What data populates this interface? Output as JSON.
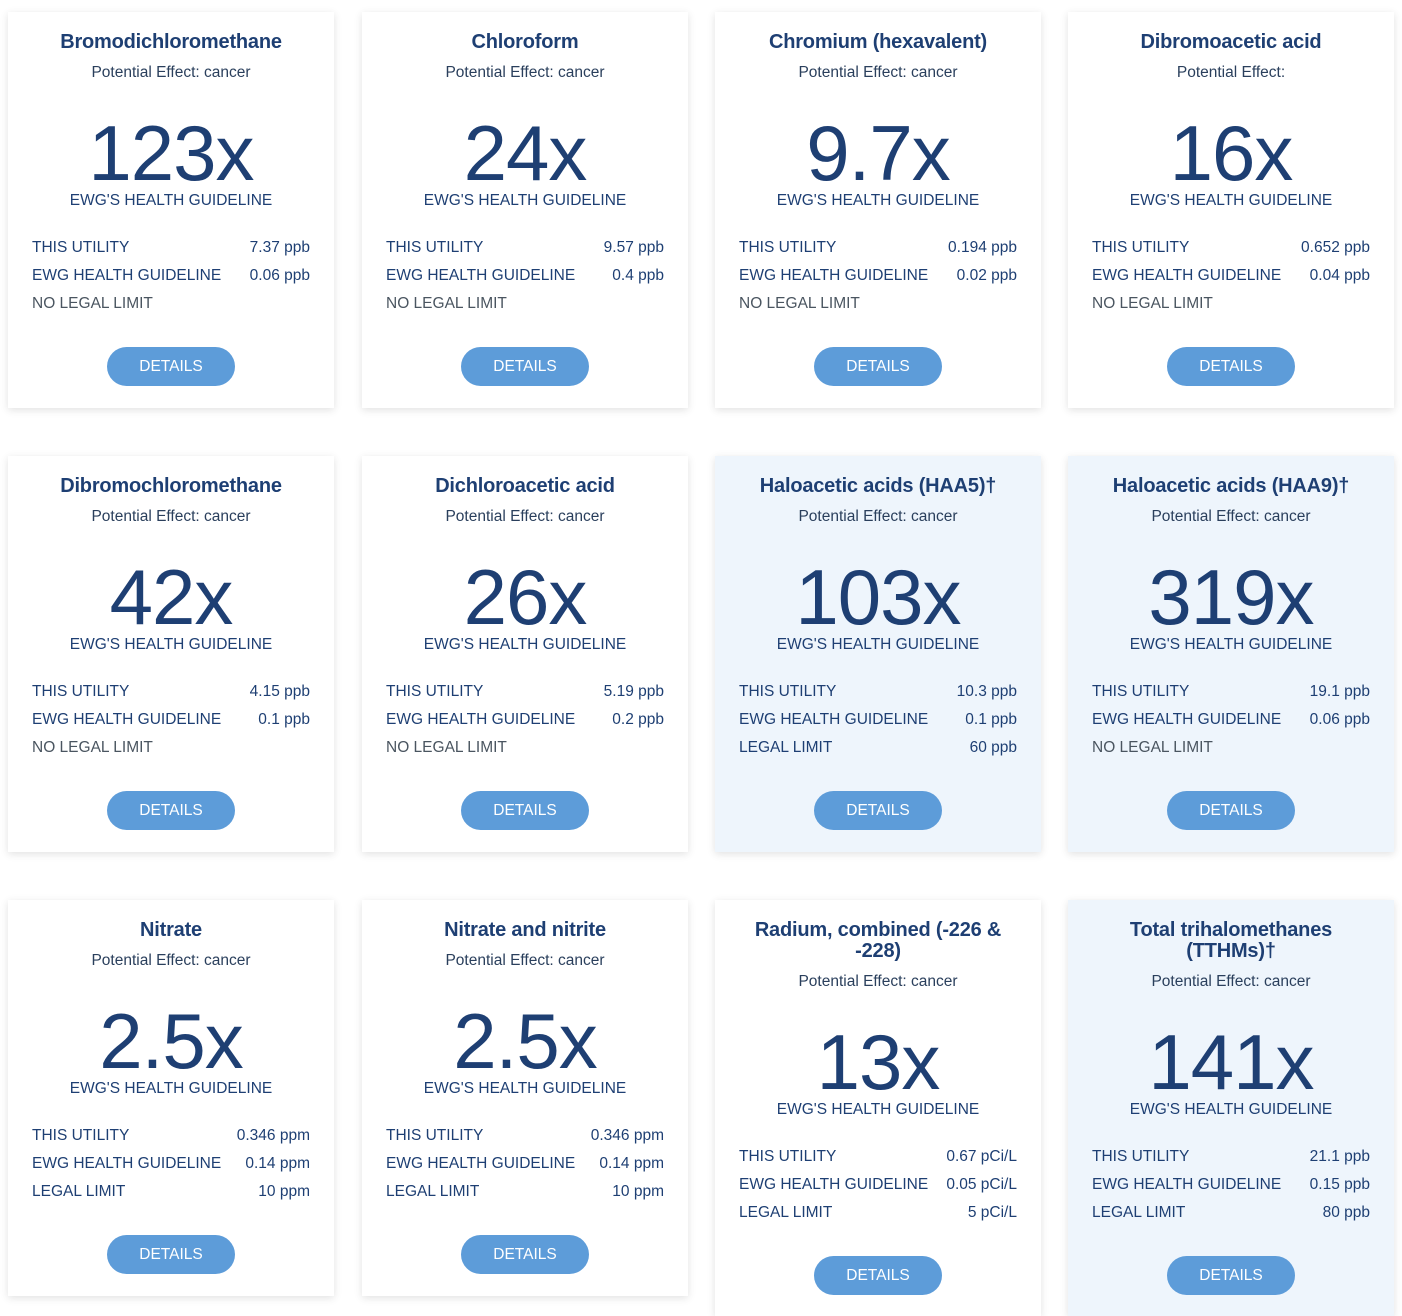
{
  "cards": [
    {
      "title": "Bromodichloromethane",
      "effect": "Potential Effect: cancer",
      "multiple": "123x",
      "guideline_label": "EWG'S HEALTH GUIDELINE",
      "stats": [
        {
          "label": "THIS UTILITY",
          "value": "7.37 ppb"
        },
        {
          "label": "EWG HEALTH GUIDELINE",
          "value": "0.06 ppb"
        },
        {
          "label": "NO LEGAL LIMIT",
          "value": ""
        }
      ],
      "button": "DETAILS"
    },
    {
      "title": "Chloroform",
      "effect": "Potential Effect: cancer",
      "multiple": "24x",
      "guideline_label": "EWG'S HEALTH GUIDELINE",
      "stats": [
        {
          "label": "THIS UTILITY",
          "value": "9.57 ppb"
        },
        {
          "label": "EWG HEALTH GUIDELINE",
          "value": "0.4 ppb"
        },
        {
          "label": "NO LEGAL LIMIT",
          "value": ""
        }
      ],
      "button": "DETAILS"
    },
    {
      "title": "Chromium (hexavalent)",
      "effect": "Potential Effect: cancer",
      "multiple": "9.7x",
      "guideline_label": "EWG'S HEALTH GUIDELINE",
      "stats": [
        {
          "label": "THIS UTILITY",
          "value": "0.194 ppb"
        },
        {
          "label": "EWG HEALTH GUIDELINE",
          "value": "0.02 ppb"
        },
        {
          "label": "NO LEGAL LIMIT",
          "value": ""
        }
      ],
      "button": "DETAILS"
    },
    {
      "title": "Dibromoacetic acid",
      "effect": "Potential Effect:",
      "multiple": "16x",
      "guideline_label": "EWG'S HEALTH GUIDELINE",
      "stats": [
        {
          "label": "THIS UTILITY",
          "value": "0.652 ppb"
        },
        {
          "label": "EWG HEALTH GUIDELINE",
          "value": "0.04 ppb"
        },
        {
          "label": "NO LEGAL LIMIT",
          "value": ""
        }
      ],
      "button": "DETAILS"
    },
    {
      "title": "Dibromochloromethane",
      "effect": "Potential Effect: cancer",
      "multiple": "42x",
      "guideline_label": "EWG'S HEALTH GUIDELINE",
      "stats": [
        {
          "label": "THIS UTILITY",
          "value": "4.15 ppb"
        },
        {
          "label": "EWG HEALTH GUIDELINE",
          "value": "0.1 ppb"
        },
        {
          "label": "NO LEGAL LIMIT",
          "value": ""
        }
      ],
      "button": "DETAILS"
    },
    {
      "title": "Dichloroacetic acid",
      "effect": "Potential Effect: cancer",
      "multiple": "26x",
      "guideline_label": "EWG'S HEALTH GUIDELINE",
      "stats": [
        {
          "label": "THIS UTILITY",
          "value": "5.19 ppb"
        },
        {
          "label": "EWG HEALTH GUIDELINE",
          "value": "0.2 ppb"
        },
        {
          "label": "NO LEGAL LIMIT",
          "value": ""
        }
      ],
      "button": "DETAILS"
    },
    {
      "title": "Haloacetic acids (HAA5)†",
      "effect": "Potential Effect: cancer",
      "multiple": "103x",
      "guideline_label": "EWG'S HEALTH GUIDELINE",
      "stats": [
        {
          "label": "THIS UTILITY",
          "value": "10.3 ppb"
        },
        {
          "label": "EWG HEALTH GUIDELINE",
          "value": "0.1 ppb"
        },
        {
          "label": "LEGAL LIMIT",
          "value": "60 ppb"
        }
      ],
      "button": "DETAILS"
    },
    {
      "title": "Haloacetic acids (HAA9)†",
      "effect": "Potential Effect: cancer",
      "multiple": "319x",
      "guideline_label": "EWG'S HEALTH GUIDELINE",
      "stats": [
        {
          "label": "THIS UTILITY",
          "value": "19.1 ppb"
        },
        {
          "label": "EWG HEALTH GUIDELINE",
          "value": "0.06 ppb"
        },
        {
          "label": "NO LEGAL LIMIT",
          "value": ""
        }
      ],
      "button": "DETAILS"
    },
    {
      "title": "Nitrate",
      "effect": "Potential Effect: cancer",
      "multiple": "2.5x",
      "guideline_label": "EWG'S HEALTH GUIDELINE",
      "stats": [
        {
          "label": "THIS UTILITY",
          "value": "0.346 ppm"
        },
        {
          "label": "EWG HEALTH GUIDELINE",
          "value": "0.14 ppm"
        },
        {
          "label": "LEGAL LIMIT",
          "value": "10 ppm"
        }
      ],
      "button": "DETAILS"
    },
    {
      "title": "Nitrate and nitrite",
      "effect": "Potential Effect: cancer",
      "multiple": "2.5x",
      "guideline_label": "EWG'S HEALTH GUIDELINE",
      "stats": [
        {
          "label": "THIS UTILITY",
          "value": "0.346 ppm"
        },
        {
          "label": "EWG HEALTH GUIDELINE",
          "value": "0.14 ppm"
        },
        {
          "label": "LEGAL LIMIT",
          "value": "10 ppm"
        }
      ],
      "button": "DETAILS"
    },
    {
      "title": "Radium, combined (-226 & -228)",
      "effect": "Potential Effect: cancer",
      "multiple": "13x",
      "guideline_label": "EWG'S HEALTH GUIDELINE",
      "stats": [
        {
          "label": "THIS UTILITY",
          "value": "0.67 pCi/L"
        },
        {
          "label": "EWG HEALTH GUIDELINE",
          "value": "0.05 pCi/L"
        },
        {
          "label": "LEGAL LIMIT",
          "value": "5 pCi/L"
        }
      ],
      "button": "DETAILS"
    },
    {
      "title": "Total trihalomethanes (TTHMs)†",
      "effect": "Potential Effect: cancer",
      "multiple": "141x",
      "guideline_label": "EWG'S HEALTH GUIDELINE",
      "stats": [
        {
          "label": "THIS UTILITY",
          "value": "21.1 ppb"
        },
        {
          "label": "EWG HEALTH GUIDELINE",
          "value": "0.15 ppb"
        },
        {
          "label": "LEGAL LIMIT",
          "value": "80 ppb"
        }
      ],
      "button": "DETAILS"
    }
  ],
  "theme": {
    "title_color": "#1e3f73",
    "button_color": "#5d9cd9",
    "highlight_background": "#eef5fc"
  }
}
